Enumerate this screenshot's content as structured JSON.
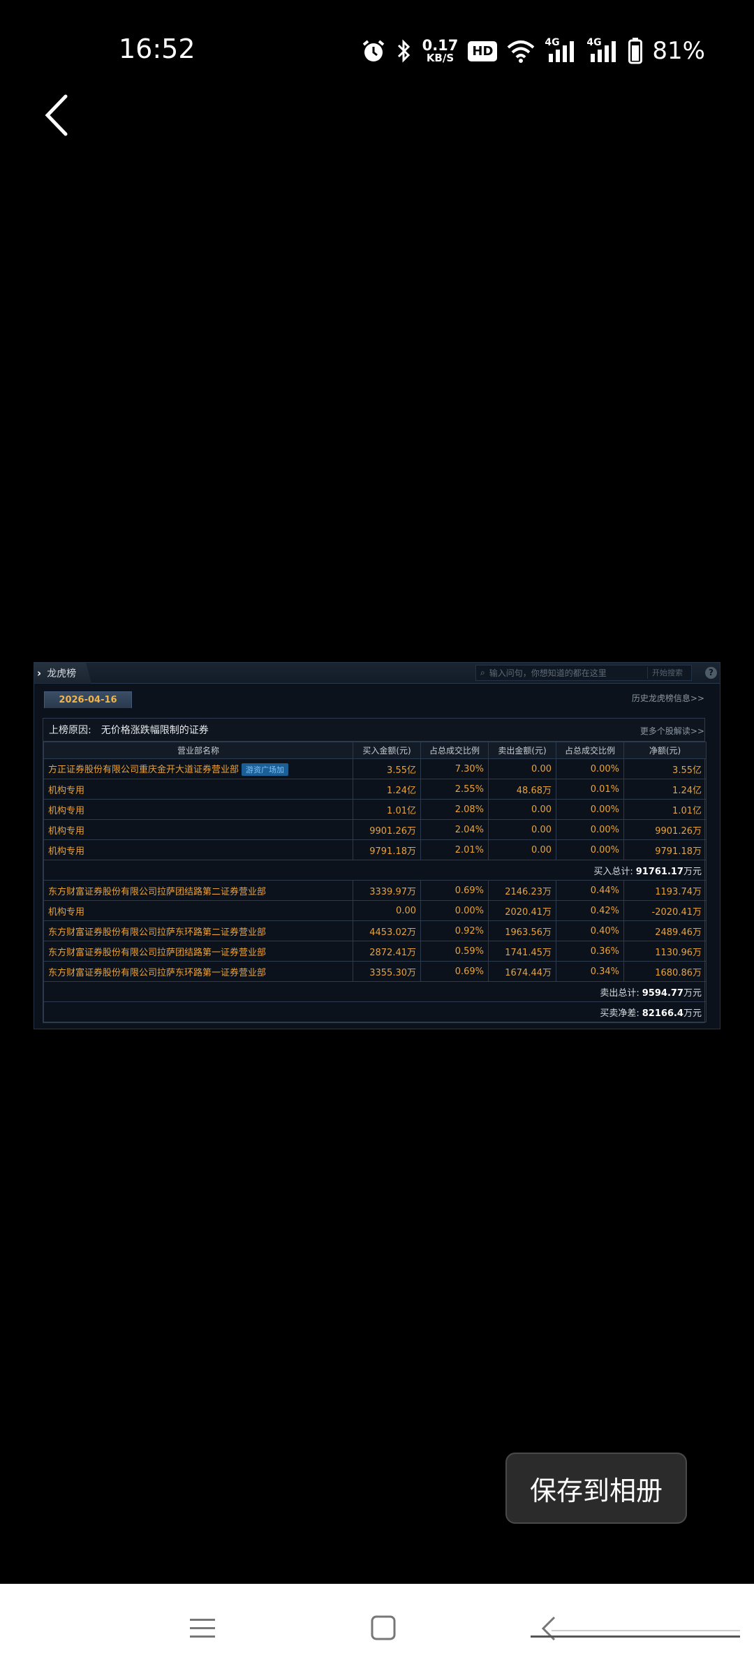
{
  "status": {
    "time": "16:52",
    "net_speed_value": "0.17",
    "net_speed_unit": "KB/S",
    "hd_label": "HD",
    "signal1": "4G",
    "signal2": "4G",
    "battery": "81%"
  },
  "panel": {
    "tab_title": "龙虎榜",
    "search_placeholder": "输入问句，你想知道的都在这里",
    "search_button": "开始搜索",
    "help": "?",
    "date": "2026-04-16",
    "history_link": "历史龙虎榜信息>>",
    "reason_label": "上榜原因:",
    "reason_value": "无价格涨跌幅限制的证券",
    "more_link": "更多个股解读>>",
    "columns": [
      "营业部名称",
      "买入金额(元)",
      "占总成交比例",
      "卖出金额(元)",
      "占总成交比例",
      "净额(元)"
    ],
    "buy_rows": [
      {
        "name": "方正证券股份有限公司重庆金开大道证券营业部",
        "badge": "游资广场加",
        "buy": "3.55亿",
        "buy_pct": "7.30%",
        "sell": "0.00",
        "sell_pct": "0.00%",
        "net": "3.55亿"
      },
      {
        "name": "机构专用",
        "buy": "1.24亿",
        "buy_pct": "2.55%",
        "sell": "48.68万",
        "sell_pct": "0.01%",
        "net": "1.24亿"
      },
      {
        "name": "机构专用",
        "buy": "1.01亿",
        "buy_pct": "2.08%",
        "sell": "0.00",
        "sell_pct": "0.00%",
        "net": "1.01亿"
      },
      {
        "name": "机构专用",
        "buy": "9901.26万",
        "buy_pct": "2.04%",
        "sell": "0.00",
        "sell_pct": "0.00%",
        "net": "9901.26万"
      },
      {
        "name": "机构专用",
        "buy": "9791.18万",
        "buy_pct": "2.01%",
        "sell": "0.00",
        "sell_pct": "0.00%",
        "net": "9791.18万"
      }
    ],
    "buy_total_label": "买入总计:",
    "buy_total_value": "91761.17",
    "buy_total_unit": "万元",
    "sell_rows": [
      {
        "name": "东方财富证券股份有限公司拉萨团结路第二证券营业部",
        "buy": "3339.97万",
        "buy_pct": "0.69%",
        "sell": "2146.23万",
        "sell_pct": "0.44%",
        "net": "1193.74万"
      },
      {
        "name": "机构专用",
        "buy": "0.00",
        "buy_pct": "0.00%",
        "sell": "2020.41万",
        "sell_pct": "0.42%",
        "net": "-2020.41万"
      },
      {
        "name": "东方财富证券股份有限公司拉萨东环路第二证券营业部",
        "buy": "4453.02万",
        "buy_pct": "0.92%",
        "sell": "1963.56万",
        "sell_pct": "0.40%",
        "net": "2489.46万"
      },
      {
        "name": "东方财富证券股份有限公司拉萨团结路第一证券营业部",
        "buy": "2872.41万",
        "buy_pct": "0.59%",
        "sell": "1741.45万",
        "sell_pct": "0.36%",
        "net": "1130.96万"
      },
      {
        "name": "东方财富证券股份有限公司拉萨东环路第一证券营业部",
        "buy": "3355.30万",
        "buy_pct": "0.69%",
        "sell": "1674.44万",
        "sell_pct": "0.34%",
        "net": "1680.86万"
      }
    ],
    "sell_total_label": "卖出总计:",
    "sell_total_value": "9594.77",
    "sell_total_unit": "万元",
    "net_total_label": "买卖净差:",
    "net_total_value": "82166.4",
    "net_total_unit": "万元"
  },
  "save_button": "保存到相册",
  "colors": {
    "accent_orange": "#e8a33c",
    "date_gold": "#f0b44a",
    "panel_bg": "#0c121b"
  }
}
